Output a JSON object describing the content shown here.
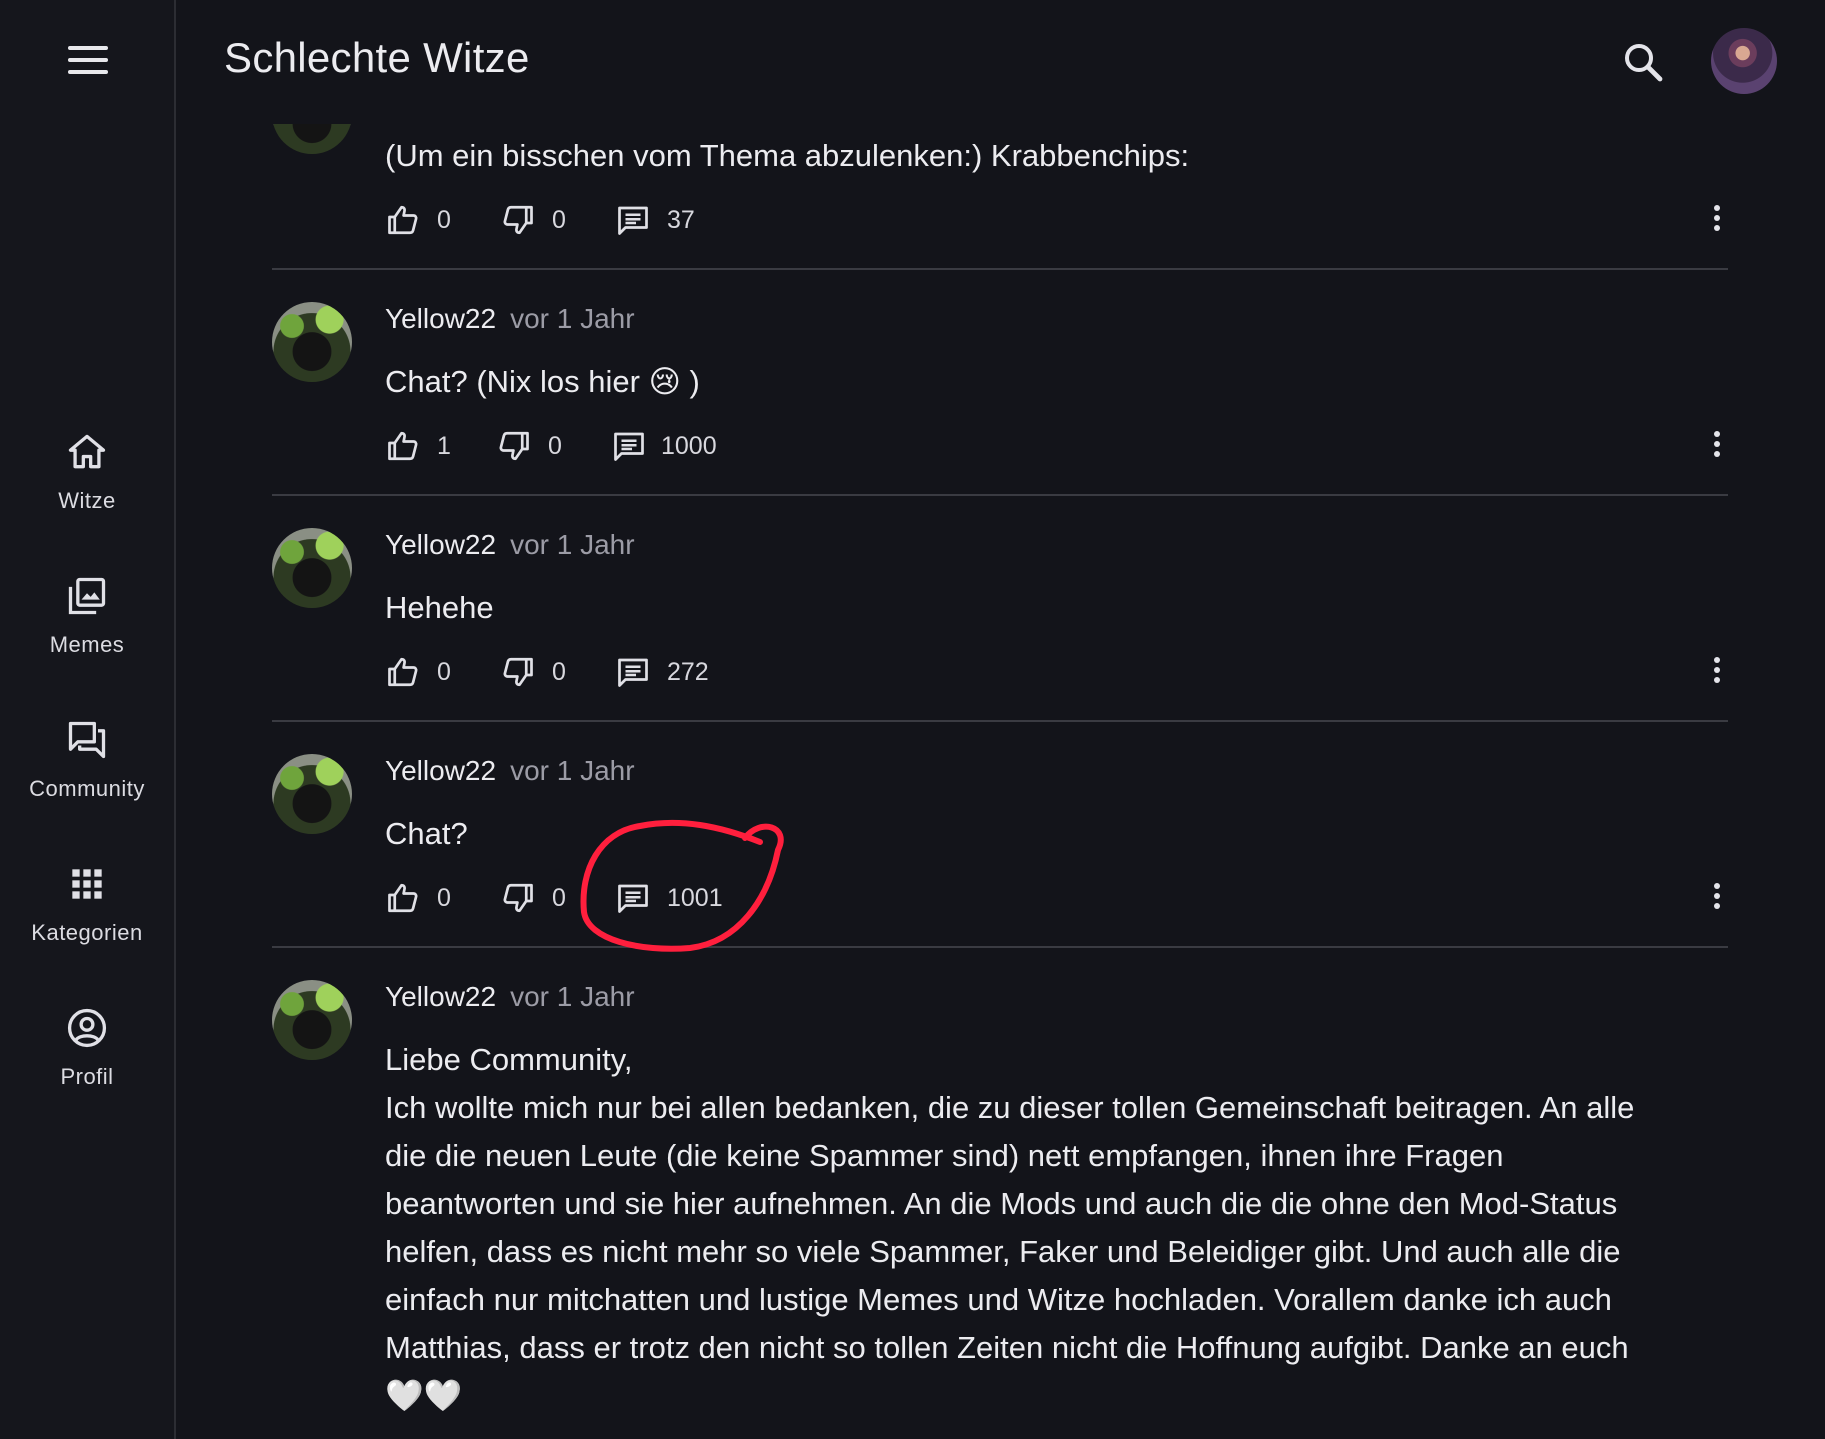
{
  "app": {
    "title": "Schlechte Witze"
  },
  "sidebar": {
    "items": [
      {
        "label": "Witze",
        "icon": "home-icon"
      },
      {
        "label": "Memes",
        "icon": "image-library-icon"
      },
      {
        "label": "Community",
        "icon": "chat-bubbles-icon"
      },
      {
        "label": "Kategorien",
        "icon": "grid-icon"
      },
      {
        "label": "Profil",
        "icon": "account-circle-icon"
      }
    ]
  },
  "posts": [
    {
      "text": "(Um ein bisschen vom Thema abzulenken:) Krabbenchips:",
      "likes": "0",
      "dislikes": "0",
      "comments": "37"
    },
    {
      "author": "Yellow22",
      "time": "vor 1 Jahr",
      "text": "Chat? (Nix los hier 😢 )",
      "likes": "1",
      "dislikes": "0",
      "comments": "1000"
    },
    {
      "author": "Yellow22",
      "time": "vor 1 Jahr",
      "text": "Hehehe",
      "likes": "0",
      "dislikes": "0",
      "comments": "272"
    },
    {
      "author": "Yellow22",
      "time": "vor 1 Jahr",
      "text": "Chat?",
      "likes": "0",
      "dislikes": "0",
      "comments": "1001"
    },
    {
      "author": "Yellow22",
      "time": "vor 1 Jahr",
      "text_lines": [
        "Liebe Community,",
        "Ich wollte mich nur bei allen bedanken, die zu dieser tollen Gemeinschaft beitragen. An alle",
        "die die neuen Leute (die keine Spammer sind) nett empfangen, ihnen ihre Fragen",
        "beantworten und sie hier aufnehmen. An die Mods und auch die die ohne den Mod-Status",
        "helfen, dass es nicht mehr so viele Spammer, Faker und Beleidiger gibt. Und auch alle die",
        "einfach nur mitchatten und lustige Memes und Witze hochladen. Vorallem danke ich auch",
        "Matthias, dass er trotz den nicht so tollen Zeiten nicht die Hoffnung aufgibt. Danke an euch",
        "🤍🤍"
      ]
    }
  ],
  "colors": {
    "background": "#13141a",
    "sidebar": "#15161c",
    "divider": "#3a3b42",
    "text": "#ececf0",
    "muted_text": "#9c9ca6",
    "annotation_circle": "#ff1f3d"
  }
}
